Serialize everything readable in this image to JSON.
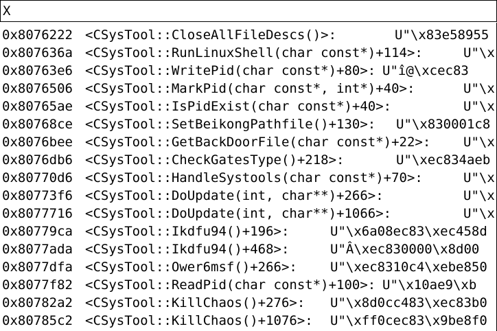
{
  "search": {
    "value": "X"
  },
  "rows": [
    {
      "addr": "0x8076222",
      "sym": "<CSysTool::CloseAllFileDescs()>:",
      "bytes": "U\"\\x83e58955"
    },
    {
      "addr": "0x807636a",
      "sym": "<CSysTool::RunLinuxShell(char const*)+114>:",
      "bytes": "U\"\\x"
    },
    {
      "addr": "0x80763e6",
      "sym": "<CSysTool::WritePid(char const*)+80>:",
      "bytes": "U\"î\u0001@\\xcec83"
    },
    {
      "addr": "0x8076506",
      "sym": "<CSysTool::MarkPid(char const*, int*)+40>:",
      "bytes": "U\"\\x"
    },
    {
      "addr": "0x80765ae",
      "sym": "<CSysTool::IsPidExist(char const*)+40>:",
      "bytes": "U\"\\x"
    },
    {
      "addr": "0x80768ce",
      "sym": "<CSysTool::SetBeikongPathfile()+130>:",
      "bytes": "U\"\\x830001c8"
    },
    {
      "addr": "0x8076bee",
      "sym": "<CSysTool::GetBackDoorFile(char const*)+22>:",
      "bytes": "U\"\\x"
    },
    {
      "addr": "0x8076db6",
      "sym": "<CSysTool::CheckGatesType()+218>:",
      "bytes": "U\"\\xec834aeb"
    },
    {
      "addr": "0x80770d6",
      "sym": "<CSysTool::HandleSystools(char const*)+70>:",
      "bytes": "U\"\\x"
    },
    {
      "addr": "0x80773f6",
      "sym": "<CSysTool::DoUpdate(int, char**)+266>:",
      "bytes": "U\"\\x"
    },
    {
      "addr": "0x8077716",
      "sym": "<CSysTool::DoUpdate(int, char**)+1066>:",
      "bytes": "U\"\\x"
    },
    {
      "addr": "0x80779ca",
      "sym": "<CSysTool::Ikdfu94()+196>:",
      "bytes": "U\"\\x6a08ec83\\xec458d"
    },
    {
      "addr": "0x8077ada",
      "sym": "<CSysTool::Ikdfu94()+468>:",
      "bytes": "U\"Â\u0001\\xec830000\\x8d00"
    },
    {
      "addr": "0x8077dfa",
      "sym": "<CSysTool::Ower6msf()+266>:",
      "bytes": "U\"\\xec8310c4\\xebe850"
    },
    {
      "addr": "0x8077f82",
      "sym": "<CSysTool::ReadPid(char const*)+100>:",
      "bytes": "U\"\\x10ae9\\xb"
    },
    {
      "addr": "0x80782a2",
      "sym": "<CSysTool::KillChaos()+276>:",
      "bytes": "U\"\\x8d0cc483\\xec83b0"
    },
    {
      "addr": "0x80785c2",
      "sym": "<CSysTool::KillChaos()+1076>:",
      "bytes": "U\"\\xff0cec83\\x9be8f0"
    }
  ],
  "bytes_x": [
    575,
    675,
    557,
    675,
    675,
    577,
    675,
    577,
    675,
    675,
    675,
    481,
    481,
    481,
    557,
    481,
    481
  ]
}
